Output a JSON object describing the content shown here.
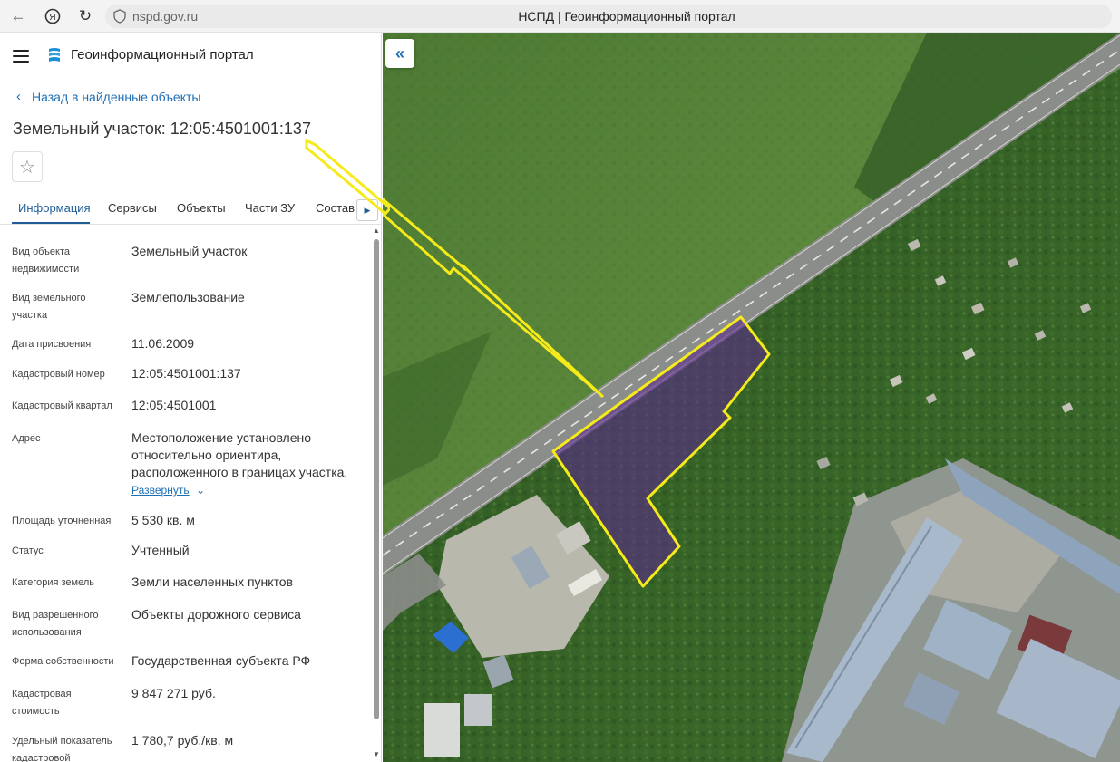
{
  "browser": {
    "url": "nspd.gov.ru",
    "tab_title": "НСПД | Геоинформационный портал"
  },
  "header": {
    "portal_title": "Геоинформационный портал"
  },
  "nav": {
    "back_label": "Назад в найденные объекты"
  },
  "object": {
    "title": "Земельный участок: 12:05:4501001:137"
  },
  "tabs": [
    {
      "label": "Информация",
      "active": true
    },
    {
      "label": "Сервисы"
    },
    {
      "label": "Объекты"
    },
    {
      "label": "Части ЗУ"
    },
    {
      "label": "Состав"
    }
  ],
  "properties": [
    {
      "label": "Вид объекта недвижимости",
      "value": "Земельный участок"
    },
    {
      "label": "Вид земельного участка",
      "value": "Землепользование"
    },
    {
      "label": "Дата присвоения",
      "value": "11.06.2009"
    },
    {
      "label": "Кадастровый номер",
      "value": "12:05:4501001:137"
    },
    {
      "label": "Кадастровый квартал",
      "value": "12:05:4501001"
    },
    {
      "label": "Адрес",
      "value": "Местоположение установлено относительно ориентира, расположенного в границах участка."
    },
    {
      "label": "Площадь уточненная",
      "value": "5 530 кв. м"
    },
    {
      "label": "Статус",
      "value": "Учтенный"
    },
    {
      "label": "Категория земель",
      "value": "Земли населенных пунктов"
    },
    {
      "label": "Вид разрешенного использования",
      "value": "Объекты дорожного сервиса"
    },
    {
      "label": "Форма собственности",
      "value": "Государственная субъекта РФ"
    },
    {
      "label": "Кадастровая стоимость",
      "value": "9 847 271 руб."
    },
    {
      "label": "Удельный показатель кадастровой",
      "value": "1 780,7 руб./кв. м"
    }
  ],
  "address_expand_label": "Развернуть",
  "colors": {
    "accent": "#1f6fb5",
    "parcel_outline": "#f5ea1a",
    "parcel_fill": "#5a2a8a"
  },
  "icons": {
    "menu": "hamburger-icon",
    "logo": "portal-logo-icon",
    "back": "chevron-left-icon",
    "favorite": "star-icon",
    "collapse": "double-chevron-left-icon"
  }
}
